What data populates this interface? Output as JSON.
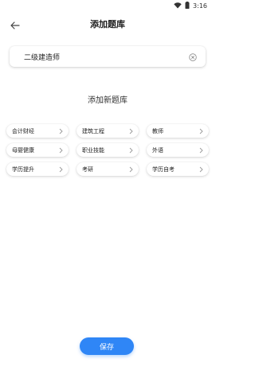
{
  "status": {
    "time": "3:16",
    "icons": [
      "wifi-icon",
      "battery-icon"
    ]
  },
  "header": {
    "title": "添加题库",
    "back_icon": "back-arrow-icon"
  },
  "search": {
    "value": "二级建造师",
    "clear_icon": "clear-icon"
  },
  "section": {
    "title": "添加新题库"
  },
  "categories": [
    {
      "label": "会计财经"
    },
    {
      "label": "建筑工程"
    },
    {
      "label": "教师"
    },
    {
      "label": "母婴健康"
    },
    {
      "label": "职业技能"
    },
    {
      "label": "外语"
    },
    {
      "label": "学历提升"
    },
    {
      "label": "考研"
    },
    {
      "label": "学历自考"
    }
  ],
  "actions": {
    "save_label": "保存"
  },
  "colors": {
    "accent": "#2f86f6",
    "background": "#ffffff"
  }
}
